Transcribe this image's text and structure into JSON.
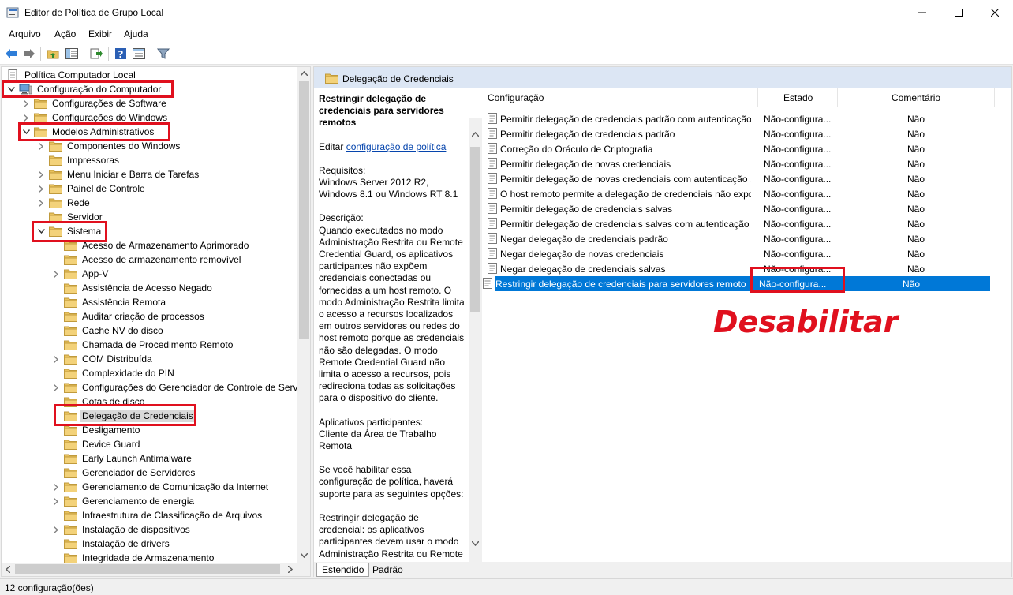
{
  "window": {
    "title": "Editor de Política de Grupo Local"
  },
  "menu": [
    "Arquivo",
    "Ação",
    "Exibir",
    "Ajuda"
  ],
  "toolbar": [
    "back-icon",
    "forward-icon",
    "up-folder-icon",
    "show-hide-tree-icon",
    "export-list-icon",
    "help-icon",
    "properties-icon",
    "filter-icon"
  ],
  "tree": {
    "root": "Política Computador Local",
    "nodes": [
      {
        "label": "Configuração do Computador",
        "expander": "open"
      },
      {
        "label": "Configurações de Software",
        "expander": "closed"
      },
      {
        "label": "Configurações do Windows",
        "expander": "closed"
      },
      {
        "label": "Modelos Administrativos",
        "expander": "open"
      },
      {
        "label": "Componentes do Windows",
        "expander": "closed"
      },
      {
        "label": "Impressoras",
        "expander": "none"
      },
      {
        "label": "Menu Iniciar e Barra de Tarefas",
        "expander": "closed"
      },
      {
        "label": "Painel de Controle",
        "expander": "closed"
      },
      {
        "label": "Rede",
        "expander": "closed"
      },
      {
        "label": "Servidor",
        "expander": "none"
      },
      {
        "label": "Sistema",
        "expander": "open"
      },
      {
        "label": "Acesso de Armazenamento Aprimorado",
        "expander": "none"
      },
      {
        "label": "Acesso de armazenamento removível",
        "expander": "none"
      },
      {
        "label": "App-V",
        "expander": "closed"
      },
      {
        "label": "Assistência de Acesso Negado",
        "expander": "none"
      },
      {
        "label": "Assistência Remota",
        "expander": "none"
      },
      {
        "label": "Auditar criação de processos",
        "expander": "none"
      },
      {
        "label": "Cache NV do disco",
        "expander": "none"
      },
      {
        "label": "Chamada de Procedimento Remoto",
        "expander": "none"
      },
      {
        "label": "COM Distribuída",
        "expander": "closed"
      },
      {
        "label": "Complexidade do PIN",
        "expander": "none"
      },
      {
        "label": "Configurações do Gerenciador de Controle de Servi",
        "expander": "closed"
      },
      {
        "label": "Cotas de disco",
        "expander": "none"
      },
      {
        "label": "Delegação de Credenciais",
        "expander": "none",
        "selected": true
      },
      {
        "label": "Desligamento",
        "expander": "none"
      },
      {
        "label": "Device Guard",
        "expander": "none"
      },
      {
        "label": "Early Launch Antimalware",
        "expander": "none"
      },
      {
        "label": "Gerenciador de Servidores",
        "expander": "none"
      },
      {
        "label": "Gerenciamento de Comunicação da Internet",
        "expander": "closed"
      },
      {
        "label": "Gerenciamento de energia",
        "expander": "closed"
      },
      {
        "label": "Infraestrutura de Classificação de Arquivos",
        "expander": "none"
      },
      {
        "label": "Instalação de dispositivos",
        "expander": "closed"
      },
      {
        "label": "Instalação de drivers",
        "expander": "none"
      },
      {
        "label": "Integridade de Armazenamento",
        "expander": "none"
      }
    ]
  },
  "right": {
    "header_title": "Delegação de Credenciais",
    "description": {
      "heading": "Restringir delegação de credenciais para servidores remotos",
      "edit_prefix": "Editar ",
      "edit_link": "configuração de política",
      "requirements": "Requisitos:\nWindows Server 2012 R2, Windows 8.1 ou Windows RT 8.1",
      "description": "Descrição:\nQuando executados no modo Administração Restrita ou Remote Credential Guard, os aplicativos participantes não expõem credenciais conectadas ou fornecidas a um host remoto. O modo Administração Restrita limita o acesso a recursos localizados em outros servidores ou redes do host remoto porque as credenciais não são delegadas. O modo Remote Credential Guard não limita o acesso a recursos, pois redireciona todas as solicitações para o dispositivo do cliente.",
      "apps": "Aplicativos participantes:\nCliente da Área de Trabalho Remota",
      "if_enabled": "Se você habilitar essa configuração de política, haverá suporte para as seguintes opções:",
      "restrict": "Restringir delegação de credencial: os aplicativos participantes devem usar o modo Administração Restrita ou Remote Credential Guard"
    },
    "columns": {
      "setting": "Configuração",
      "state": "Estado",
      "comment": "Comentário"
    },
    "rows": [
      {
        "name": "Permitir delegação de credenciais padrão com autenticação...",
        "state": "Não-configura...",
        "comment": "Não"
      },
      {
        "name": "Permitir delegação de credenciais padrão",
        "state": "Não-configura...",
        "comment": "Não"
      },
      {
        "name": "Correção do Oráculo de Criptografia",
        "state": "Não-configura...",
        "comment": "Não"
      },
      {
        "name": "Permitir delegação de novas credenciais",
        "state": "Não-configura...",
        "comment": "Não"
      },
      {
        "name": "Permitir delegação de novas credenciais com autenticação ...",
        "state": "Não-configura...",
        "comment": "Não"
      },
      {
        "name": "O host remoto permite a delegação de credenciais não expo...",
        "state": "Não-configura...",
        "comment": "Não"
      },
      {
        "name": "Permitir delegação de credenciais salvas",
        "state": "Não-configura...",
        "comment": "Não"
      },
      {
        "name": "Permitir delegação de credenciais salvas com autenticação ...",
        "state": "Não-configura...",
        "comment": "Não"
      },
      {
        "name": "Negar delegação de credenciais padrão",
        "state": "Não-configura...",
        "comment": "Não"
      },
      {
        "name": "Negar delegação de novas credenciais",
        "state": "Não-configura...",
        "comment": "Não"
      },
      {
        "name": "Negar delegação de credenciais salvas",
        "state": "Não-configura...",
        "comment": "Não"
      },
      {
        "name": "Restringir delegação de credenciais para servidores remotos",
        "state": "Não-configura...",
        "comment": "Não",
        "selected": true
      }
    ],
    "tabs": [
      "Estendido",
      "Padrão"
    ]
  },
  "annotation": "Desabilitar",
  "status": "12 configuração(ões)",
  "colors": {
    "highlight": "#0078d7",
    "annotation": "#e0101e",
    "header_band": "#dce6f4",
    "folder": "#e8c15c"
  }
}
